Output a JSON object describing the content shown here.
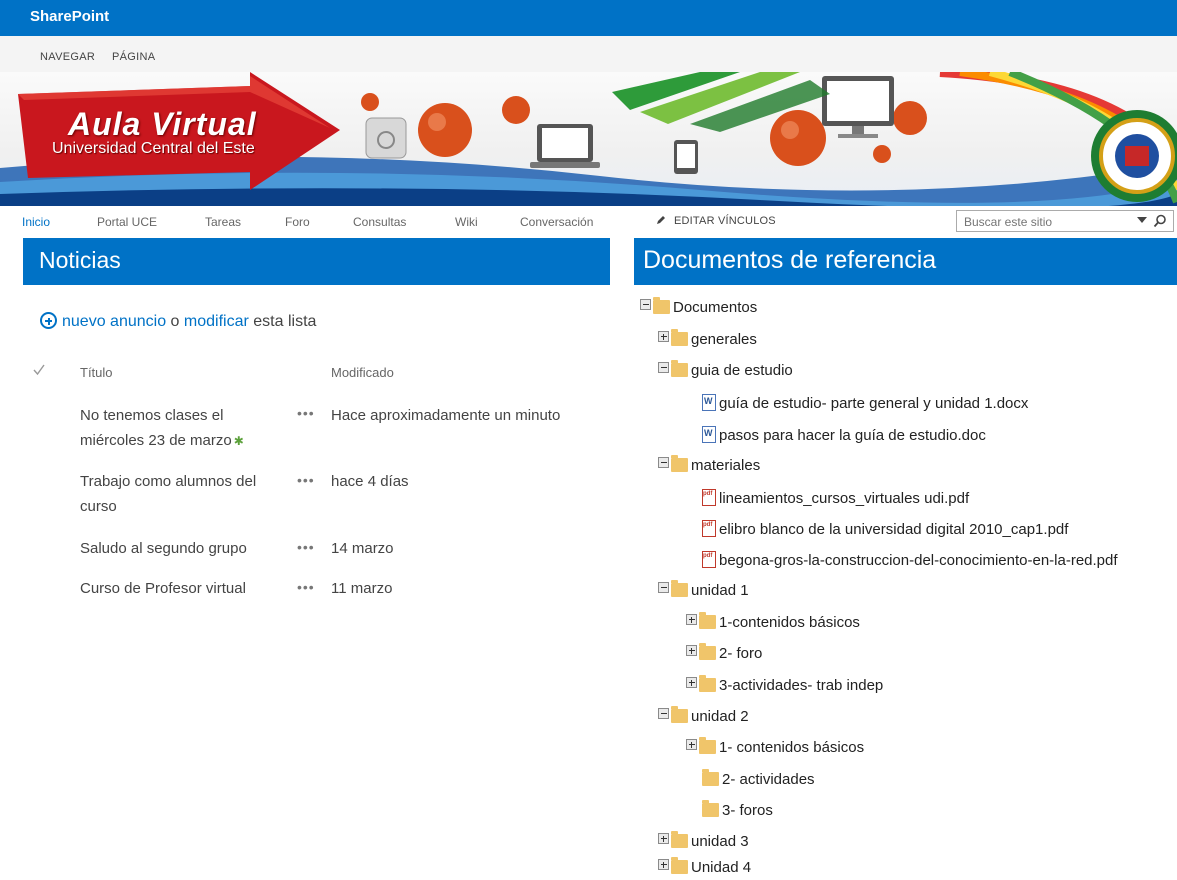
{
  "suite": {
    "brand": "SharePoint"
  },
  "ribbon": {
    "tabs": [
      "NAVEGAR",
      "PÁGINA"
    ]
  },
  "banner": {
    "title": "Aula Virtual",
    "subtitle": "Universidad Central del Este"
  },
  "topnav": {
    "items": [
      "Inicio",
      "Portal UCE",
      "Tareas",
      "Foro",
      "Consultas",
      "Wiki",
      "Conversación"
    ],
    "edit_links": "EDITAR VÍNCULOS",
    "search_placeholder": "Buscar este sitio"
  },
  "news": {
    "header": "Noticias",
    "new_link": "nuevo anuncio",
    "or_text": "o",
    "modify_link": "modificar",
    "list_text": "esta lista",
    "col_title": "Título",
    "col_modified": "Modificado",
    "rows": [
      {
        "title": "No tenemos clases el miércoles 23 de marzo",
        "modified": "Hace aproximadamente un minuto"
      },
      {
        "title": "Trabajo como alumnos del curso",
        "modified": "hace 4 días"
      },
      {
        "title": "Saludo al segundo grupo",
        "modified": "14 marzo"
      },
      {
        "title": "Curso de Profesor virtual",
        "modified": "11 marzo"
      }
    ],
    "dots": "•••",
    "new_badge": "✱"
  },
  "docs": {
    "header": "Documentos de referencia",
    "tree": [
      "Documentos",
      "generales",
      "guia de estudio",
      "guía de estudio- parte general y unidad 1.docx",
      "pasos para hacer la guía de estudio.doc",
      "materiales",
      "lineamientos_cursos_virtuales udi.pdf",
      "elibro blanco de la universidad digital 2010_cap1.pdf",
      "begona-gros-la-construccion-del-conocimiento-en-la-red.pdf",
      "unidad 1",
      "1-contenidos básicos",
      "2- foro",
      "3-actividades- trab indep",
      "unidad 2",
      "1- contenidos básicos",
      "2- actividades",
      "3- foros",
      "unidad 3",
      "Unidad 4"
    ]
  }
}
